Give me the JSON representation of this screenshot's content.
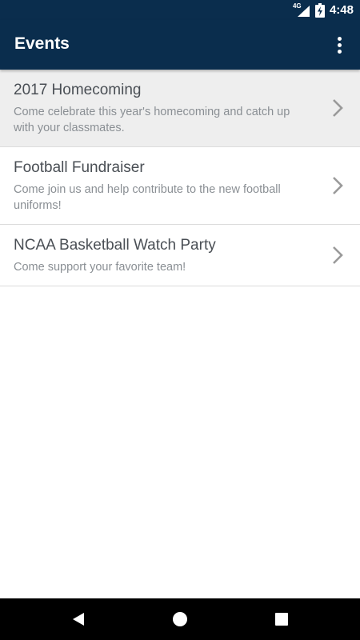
{
  "status_bar": {
    "network": "4G",
    "time": "4:48"
  },
  "app_bar": {
    "title": "Events",
    "menu_icon": "more-vert-icon"
  },
  "events": [
    {
      "title": "2017 Homecoming",
      "description": "Come celebrate this year's homecoming and catch up with your classmates.",
      "selected": true
    },
    {
      "title": "Football Fundraiser",
      "description": "Come join us and help contribute to the new football uniforms!",
      "selected": false
    },
    {
      "title": "NCAA Basketball Watch Party",
      "description": "Come support your favorite team!",
      "selected": false
    }
  ],
  "nav_bar": {
    "back_icon": "back-icon",
    "home_icon": "home-icon",
    "recents_icon": "recents-icon"
  },
  "colors": {
    "primary": "#0a2d4d",
    "selected_row": "#eeeeee",
    "divider": "#dcdcdc",
    "title_text": "#4a4f55",
    "desc_text": "#8a8f94"
  }
}
